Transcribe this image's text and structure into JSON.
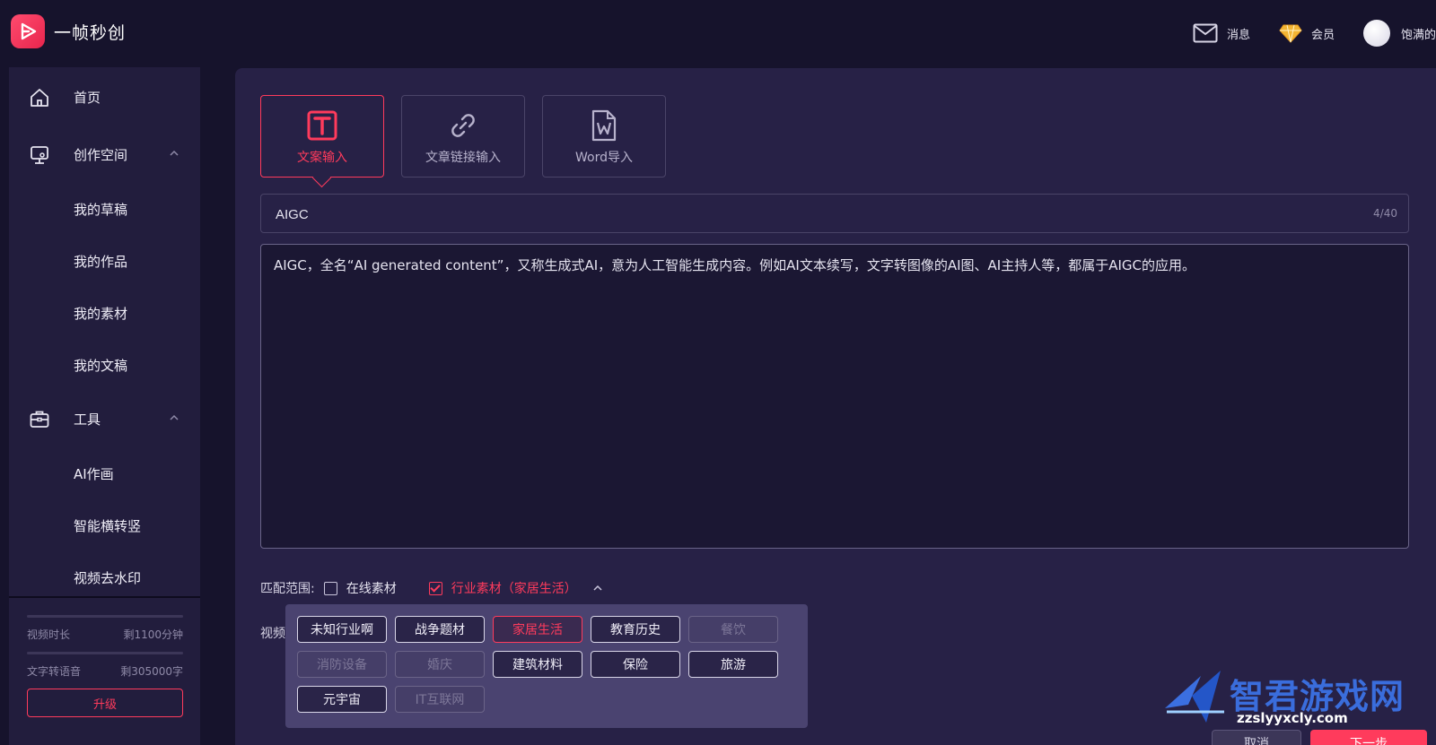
{
  "app": {
    "title": "一帧秒创"
  },
  "header": {
    "messages_label": "消息",
    "member_label": "会员",
    "user_name": "饱满的"
  },
  "sidebar": {
    "home": "首页",
    "creation_space": {
      "label": "创作空间",
      "items": [
        "我的草稿",
        "我的作品",
        "我的素材",
        "我的文稿"
      ]
    },
    "tools": {
      "label": "工具",
      "items": [
        "AI作画",
        "智能横转竖",
        "视频去水印"
      ]
    },
    "quota": {
      "video_label": "视频时长",
      "video_value": "剩1100分钟",
      "tts_label": "文字转语音",
      "tts_value": "剩305000字"
    },
    "upgrade_label": "升级"
  },
  "modes": [
    {
      "label": "文案输入",
      "icon": "text-t-icon",
      "active": true
    },
    {
      "label": "文章链接输入",
      "icon": "link-icon",
      "active": false
    },
    {
      "label": "Word导入",
      "icon": "word-file-icon",
      "active": false
    }
  ],
  "title_field": {
    "value": "AIGC",
    "counter": "4/40"
  },
  "content": {
    "text": "AIGC，全名“AI generated content”，又称生成式AI，意为人工智能生成内容。例如AI文本续写，文字转图像的AI图、AI主持人等，都属于AIGC的应用。"
  },
  "match": {
    "label": "匹配范围:",
    "online_label": "在线素材",
    "online_checked": false,
    "industry_label": "行业素材（家居生活）",
    "industry_checked": true
  },
  "video_label": "视频",
  "tags": [
    {
      "label": "未知行业啊",
      "state": "normal"
    },
    {
      "label": "战争题材",
      "state": "normal"
    },
    {
      "label": "家居生活",
      "state": "selected"
    },
    {
      "label": "教育历史",
      "state": "normal"
    },
    {
      "label": "餐饮",
      "state": "disabled"
    },
    {
      "label": "消防设备",
      "state": "disabled"
    },
    {
      "label": "婚庆",
      "state": "disabled"
    },
    {
      "label": "建筑材料",
      "state": "normal"
    },
    {
      "label": "保险",
      "state": "normal"
    },
    {
      "label": "旅游",
      "state": "normal"
    },
    {
      "label": "元宇宙",
      "state": "normal"
    },
    {
      "label": "IT互联网",
      "state": "disabled"
    }
  ],
  "footer": {
    "cancel_label": "取消",
    "next_label": "下一步"
  },
  "watermark": {
    "title": "智君游戏网",
    "url": "zzslyyxcly.com"
  },
  "colors": {
    "accent": "#ff3b5c",
    "bg": "#16132c",
    "panel": "#272146",
    "sidebar": "#221d3d"
  }
}
